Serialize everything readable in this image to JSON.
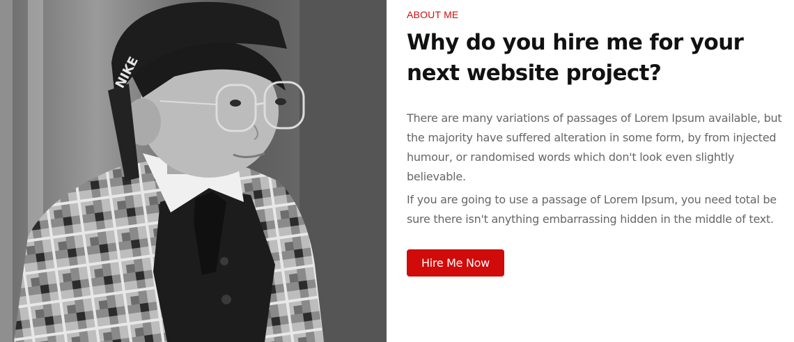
{
  "about": {
    "eyebrow": "ABOUT ME",
    "heading": "Why do you hire me for your next website project?",
    "paragraphs": [
      "There are many variations of passages of Lorem Ipsum available, but the majority have suffered alteration in some form, by from injected humour, or randomised words which don't look even slightly believable.",
      "If you are going to use a passage of Lorem Ipsum, you need total be sure there isn't anything embarrassing hidden in the middle of text."
    ],
    "button_label": "Hire Me Now",
    "cap_logo_text": "NIKE",
    "accent_color": "#d10a0a"
  }
}
